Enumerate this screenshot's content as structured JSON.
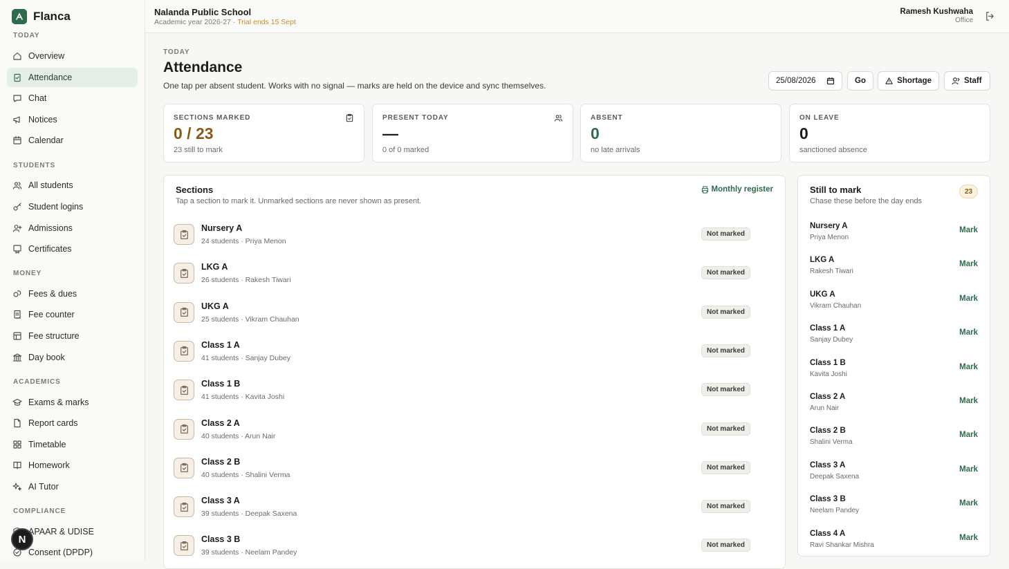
{
  "sidebar": {
    "brand": "Flanca",
    "sections": [
      {
        "label": "TODAY",
        "items": [
          {
            "label": "Overview",
            "icon": "home-icon"
          },
          {
            "label": "Attendance",
            "icon": "checklist-icon",
            "active": true
          },
          {
            "label": "Chat",
            "icon": "chat-icon"
          },
          {
            "label": "Notices",
            "icon": "megaphone-icon"
          },
          {
            "label": "Calendar",
            "icon": "calendar-icon"
          }
        ]
      },
      {
        "label": "STUDENTS",
        "items": [
          {
            "label": "All students",
            "icon": "users-icon"
          },
          {
            "label": "Student logins",
            "icon": "key-icon"
          },
          {
            "label": "Admissions",
            "icon": "user-plus-icon"
          },
          {
            "label": "Certificates",
            "icon": "certificate-icon"
          }
        ]
      },
      {
        "label": "MONEY",
        "items": [
          {
            "label": "Fees & dues",
            "icon": "coins-icon"
          },
          {
            "label": "Fee counter",
            "icon": "receipt-icon"
          },
          {
            "label": "Fee structure",
            "icon": "table-icon"
          },
          {
            "label": "Day book",
            "icon": "bank-icon"
          }
        ]
      },
      {
        "label": "ACADEMICS",
        "items": [
          {
            "label": "Exams & marks",
            "icon": "graduation-cap-icon"
          },
          {
            "label": "Report cards",
            "icon": "document-icon"
          },
          {
            "label": "Timetable",
            "icon": "grid-icon"
          },
          {
            "label": "Homework",
            "icon": "book-icon"
          },
          {
            "label": "AI Tutor",
            "icon": "sparkles-icon"
          }
        ]
      },
      {
        "label": "COMPLIANCE",
        "items": [
          {
            "label": "APAAR & UDISE",
            "icon": "shield-icon"
          },
          {
            "label": "Consent (DPDP)",
            "icon": "badge-check-icon"
          }
        ]
      }
    ],
    "fab_letter": "N"
  },
  "header": {
    "school": "Nalanda Public School",
    "academic_year": "Academic year 2026-27",
    "separator": " · ",
    "trial": "Trial ends 15 Sept",
    "user_name": "Ramesh Kushwaha",
    "user_role": "Office"
  },
  "page": {
    "eyebrow": "TODAY",
    "title": "Attendance",
    "subtitle": "One tap per absent student. Works with no signal — marks are held on the device and sync themselves.",
    "date_value": "25/08/2026",
    "go_label": "Go",
    "shortage_label": "Shortage",
    "staff_label": "Staff"
  },
  "stats": [
    {
      "label": "SECTIONS MARKED",
      "value": "0 / 23",
      "sub": "23 still to mark",
      "icon": "clipboard-check-icon",
      "color": "#8a5a15"
    },
    {
      "label": "PRESENT TODAY",
      "value": "—",
      "sub": "0 of 0 marked",
      "icon": "users-icon",
      "color": "#1c1c1a"
    },
    {
      "label": "ABSENT",
      "value": "0",
      "sub": "no late arrivals",
      "color": "#2f6b4b"
    },
    {
      "label": "ON LEAVE",
      "value": "0",
      "sub": "sanctioned absence",
      "color": "#1c1c1a"
    }
  ],
  "sections_panel": {
    "title": "Sections",
    "subtitle": "Tap a section to mark it. Unmarked sections are never shown as present.",
    "monthly_label": "Monthly register",
    "status_label": "Not marked",
    "rows": [
      {
        "name": "Nursery A",
        "meta": "24 students · Priya Menon"
      },
      {
        "name": "LKG A",
        "meta": "26 students · Rakesh Tiwari"
      },
      {
        "name": "UKG A",
        "meta": "25 students · Vikram Chauhan"
      },
      {
        "name": "Class 1 A",
        "meta": "41 students · Sanjay Dubey"
      },
      {
        "name": "Class 1 B",
        "meta": "41 students · Kavita Joshi"
      },
      {
        "name": "Class 2 A",
        "meta": "40 students · Arun Nair"
      },
      {
        "name": "Class 2 B",
        "meta": "40 students · Shalini Verma"
      },
      {
        "name": "Class 3 A",
        "meta": "39 students · Deepak Saxena"
      },
      {
        "name": "Class 3 B",
        "meta": "39 students · Neelam Pandey"
      }
    ]
  },
  "still_panel": {
    "title": "Still to mark",
    "subtitle": "Chase these before the day ends",
    "count": "23",
    "mark_label": "Mark",
    "rows": [
      {
        "name": "Nursery A",
        "teacher": "Priya Menon"
      },
      {
        "name": "LKG A",
        "teacher": "Rakesh Tiwari"
      },
      {
        "name": "UKG A",
        "teacher": "Vikram Chauhan"
      },
      {
        "name": "Class 1 A",
        "teacher": "Sanjay Dubey"
      },
      {
        "name": "Class 1 B",
        "teacher": "Kavita Joshi"
      },
      {
        "name": "Class 2 A",
        "teacher": "Arun Nair"
      },
      {
        "name": "Class 2 B",
        "teacher": "Shalini Verma"
      },
      {
        "name": "Class 3 A",
        "teacher": "Deepak Saxena"
      },
      {
        "name": "Class 3 B",
        "teacher": "Neelam Pandey"
      },
      {
        "name": "Class 4 A",
        "teacher": "Ravi Shankar Mishra"
      }
    ]
  }
}
